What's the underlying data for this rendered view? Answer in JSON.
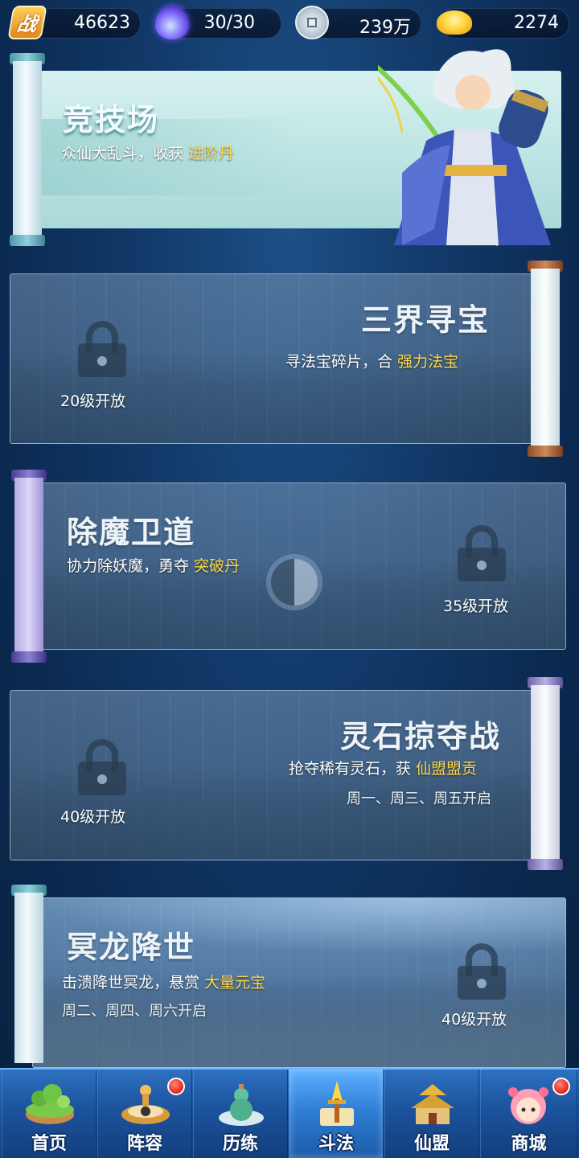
{
  "resources": {
    "power": {
      "icon": "power-icon",
      "icon_text": "战",
      "value": "46623"
    },
    "energy": {
      "icon": "energy-flame-icon",
      "value": "30/30"
    },
    "coins": {
      "icon": "copper-coin-icon",
      "value": "239万"
    },
    "gold": {
      "icon": "gold-ingot-icon",
      "value": "2274"
    }
  },
  "cards": {
    "arena": {
      "title": "竞技场",
      "desc": "众仙大乱斗，收获 ",
      "highlight": "进阶丹"
    },
    "treasure": {
      "title": "三界寻宝",
      "desc": "寻法宝碎片，合 ",
      "highlight": "强力法宝",
      "level": "20级开放"
    },
    "demon": {
      "title": "除魔卫道",
      "desc": "协力除妖魔，勇夺 ",
      "highlight": "突破丹",
      "level": "35级开放"
    },
    "spirit": {
      "title": "灵石掠夺战",
      "desc": "抢夺稀有灵石，获 ",
      "highlight": "仙盟盟贡",
      "days": "周一、周三、周五开启",
      "level": "40级开放"
    },
    "dragon": {
      "title": "冥龙降世",
      "desc": "击溃降世冥龙，悬赏 ",
      "highlight": "大量元宝",
      "days": "周二、周四、周六开启",
      "level": "40级开放"
    }
  },
  "nav": {
    "tabs": [
      {
        "label": "首页",
        "icon": "island-icon",
        "active": false,
        "badge": false
      },
      {
        "label": "阵容",
        "icon": "formation-icon",
        "active": false,
        "badge": true
      },
      {
        "label": "历练",
        "icon": "gourd-icon",
        "active": false,
        "badge": false
      },
      {
        "label": "斗法",
        "icon": "duel-icon",
        "active": true,
        "badge": false
      },
      {
        "label": "仙盟",
        "icon": "palace-icon",
        "active": false,
        "badge": false
      },
      {
        "label": "商城",
        "icon": "shop-girl-icon",
        "active": false,
        "badge": true
      }
    ]
  },
  "colors": {
    "highlight": "#ffd84a",
    "nav_active": "#4a9cf0",
    "badge": "#e3211a"
  }
}
